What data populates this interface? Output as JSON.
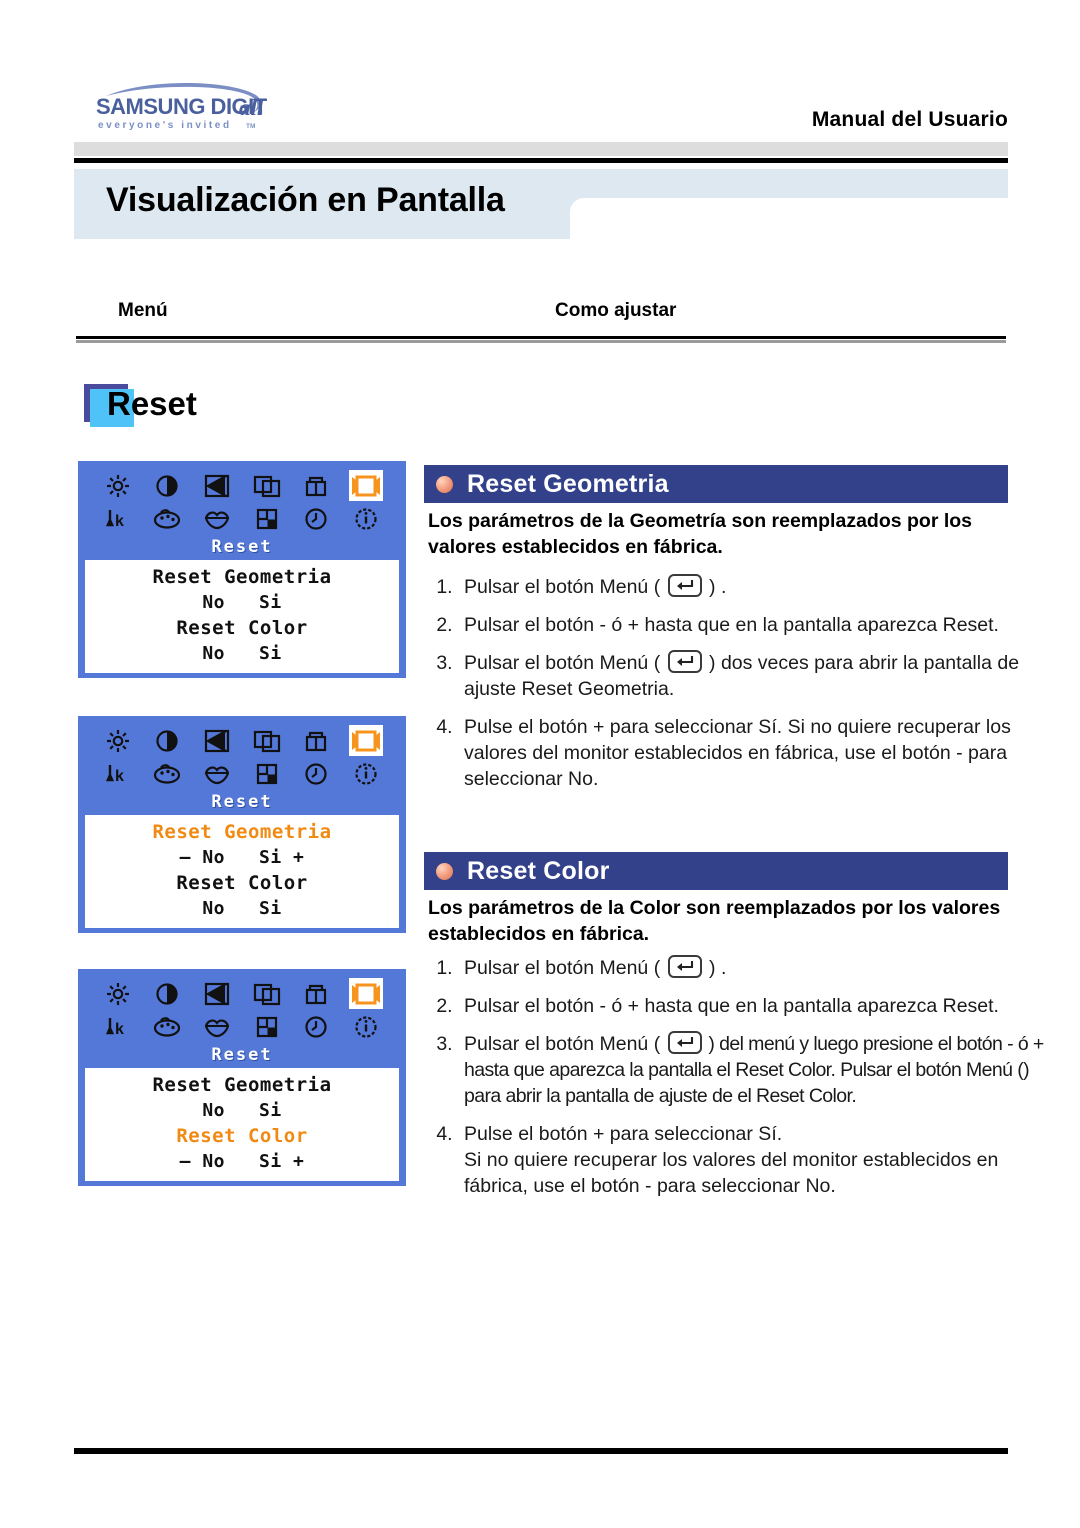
{
  "header": {
    "logo_primary": "SAMSUNG DIGITall",
    "logo_tagline": "everyone's invited™",
    "manual_title": "Manual del Usuario",
    "page_title": "Visualización en Pantalla"
  },
  "columns": {
    "menu_label": "Menú",
    "howto_label": "Como ajustar"
  },
  "chip": {
    "label": "Reset",
    "face_color": "#4fc3f7",
    "shadow_color": "#4b4b9e"
  },
  "osd": {
    "background_color": "#5478d8",
    "highlight_color": "#f08a12",
    "title": "Reset",
    "icons_row1": [
      "brightness-icon",
      "contrast-icon",
      "moire-icon",
      "position-icon",
      "size-icon",
      "reset-icon"
    ],
    "icons_row2": [
      "degauss-icon",
      "color-palette-icon",
      "color-tone-icon",
      "corner-icon",
      "clock-icon",
      "information-icon"
    ],
    "selected_icon": "reset-icon",
    "panels": [
      {
        "name": "reset-menu-default",
        "rows": [
          {
            "text": "Reset Geometria",
            "highlight": false,
            "sub": false
          },
          {
            "text": "No   Si",
            "highlight": false,
            "sub": true
          },
          {
            "text": "Reset Color",
            "highlight": false,
            "sub": false
          },
          {
            "text": "No   Si",
            "highlight": false,
            "sub": true
          }
        ]
      },
      {
        "name": "reset-geometria-selected",
        "rows": [
          {
            "text": "Reset Geometria",
            "highlight": true,
            "sub": false
          },
          {
            "text": "– No   Si +",
            "highlight": false,
            "sub": true
          },
          {
            "text": "Reset Color",
            "highlight": false,
            "sub": false
          },
          {
            "text": "No   Si",
            "highlight": false,
            "sub": true
          }
        ]
      },
      {
        "name": "reset-color-selected",
        "rows": [
          {
            "text": "Reset Geometria",
            "highlight": false,
            "sub": false
          },
          {
            "text": "No   Si",
            "highlight": false,
            "sub": true
          },
          {
            "text": "Reset Color",
            "highlight": true,
            "sub": false
          },
          {
            "text": "– No   Si +",
            "highlight": false,
            "sub": true
          }
        ]
      }
    ]
  },
  "sections": [
    {
      "id": "reset-geometria",
      "title": "Reset Geometria",
      "description": "Los parámetros de la Geometría son reemplazados por los valores establecidos en fábrica.",
      "steps": [
        {
          "before": "Pulsar el botón Menú ( ",
          "icon": "menu-button-icon",
          "after": " ) ."
        },
        {
          "before": "Pulsar el botón - ó + hasta que en la pantalla aparezca Reset.",
          "icon": null,
          "after": ""
        },
        {
          "before": "Pulsar el botón Menú ( ",
          "icon": "menu-button-icon",
          "after": " ) dos veces para abrir la pantalla de ajuste Reset Geometria."
        },
        {
          "before": "Pulse el botón + para seleccionar Sí. Si no quiere recuperar los valores del monitor establecidos en fábrica, use el botón - para seleccionar No.",
          "icon": null,
          "after": ""
        }
      ]
    },
    {
      "id": "reset-color",
      "title": "Reset Color",
      "description": "Los parámetros de la Color son reemplazados por los valores establecidos en fábrica.",
      "steps": [
        {
          "before": "Pulsar el botón Menú ( ",
          "icon": "menu-button-icon",
          "after": " ) ."
        },
        {
          "before": "Pulsar el botón - ó + hasta que en la pantalla aparezca Reset.",
          "icon": null,
          "after": ""
        },
        {
          "before": "Pulsar el botón Menú ( ",
          "icon": "menu-button-icon",
          "after": " ) del menú y luego presione el botón - ó + hasta que aparezca la pantalla el Reset Color. Pulsar el botón Menú () para abrir la pantalla de ajuste de el Reset Color."
        },
        {
          "before": "Pulse el botón + para seleccionar Sí.\nSi no quiere recuperar los valores del monitor establecidos en fábrica, use el botón - para seleccionar No.",
          "icon": null,
          "after": ""
        }
      ]
    }
  ],
  "colors": {
    "section_header_blue": "#33408a",
    "banner_light_blue": "#dde8f0",
    "bullet_orange": "#f4a185",
    "osd_blue": "#5478d8"
  }
}
